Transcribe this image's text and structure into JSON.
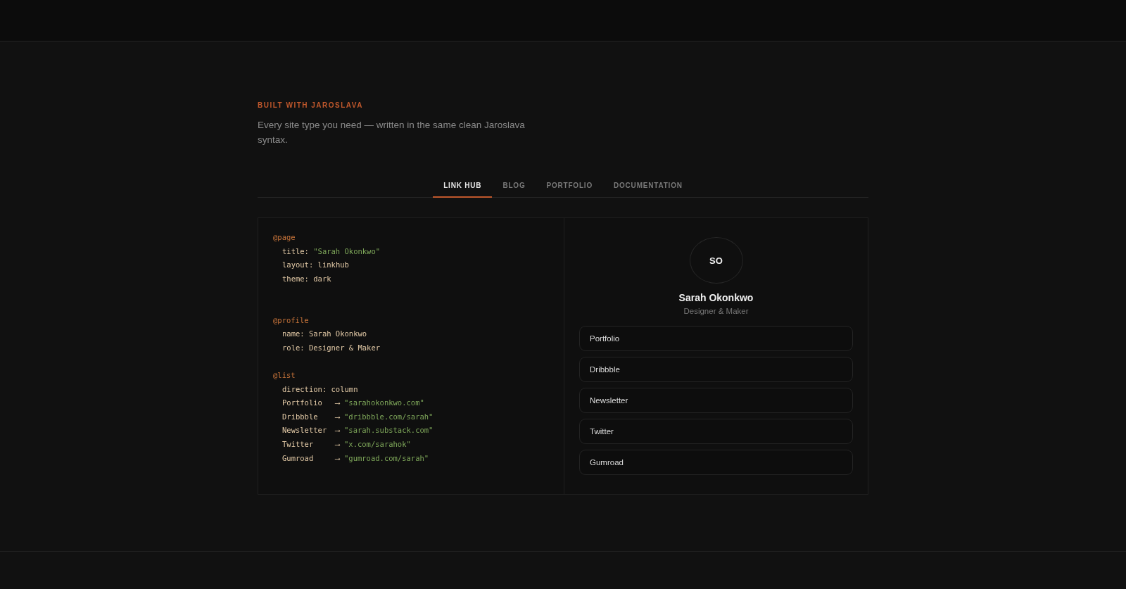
{
  "section": {
    "eyebrow": "BUILT WITH JAROSLAVA",
    "description": "Every site type you need — written in the same clean Jaroslava syntax."
  },
  "tabs": [
    {
      "label": "LINK HUB",
      "selected": true
    },
    {
      "label": "BLOG",
      "selected": false
    },
    {
      "label": "PORTFOLIO",
      "selected": false
    },
    {
      "label": "DOCUMENTATION",
      "selected": false
    }
  ],
  "code": [
    {
      "kind": "directive",
      "text": "@page"
    },
    {
      "kind": "prop",
      "key": "title:",
      "value": "\"Sarah Okonkwo\"",
      "string": true
    },
    {
      "kind": "prop",
      "key": "layout:",
      "value": "linkhub",
      "string": false
    },
    {
      "kind": "prop",
      "key": "theme:",
      "value": "dark",
      "string": false
    },
    {
      "kind": "blank"
    },
    {
      "kind": "blank"
    },
    {
      "kind": "directive",
      "text": "@profile"
    },
    {
      "kind": "prop",
      "key": "name:",
      "value": "Sarah Okonkwo",
      "string": false
    },
    {
      "kind": "prop",
      "key": "role:",
      "value": "Designer & Maker",
      "string": false
    },
    {
      "kind": "blank"
    },
    {
      "kind": "directive",
      "text": "@list"
    },
    {
      "kind": "prop",
      "key": "direction:",
      "value": "column",
      "string": false
    },
    {
      "kind": "link",
      "key": "Portfolio",
      "arrow": "⟶",
      "value": "\"sarahokonkwo.com\""
    },
    {
      "kind": "link",
      "key": "Dribbble",
      "arrow": "⟶",
      "value": "\"dribbble.com/sarah\""
    },
    {
      "kind": "link",
      "key": "Newsletter",
      "arrow": "⟶",
      "value": "\"sarah.substack.com\""
    },
    {
      "kind": "link",
      "key": "Twitter",
      "arrow": "⟶",
      "value": "\"x.com/sarahok\""
    },
    {
      "kind": "link",
      "key": "Gumroad",
      "arrow": "⟶",
      "value": "\"gumroad.com/sarah\""
    }
  ],
  "preview": {
    "initials": "SO",
    "name": "Sarah Okonkwo",
    "role": "Designer & Maker",
    "links": [
      "Portfolio",
      "Dribbble",
      "Newsletter",
      "Twitter",
      "Gumroad"
    ]
  }
}
